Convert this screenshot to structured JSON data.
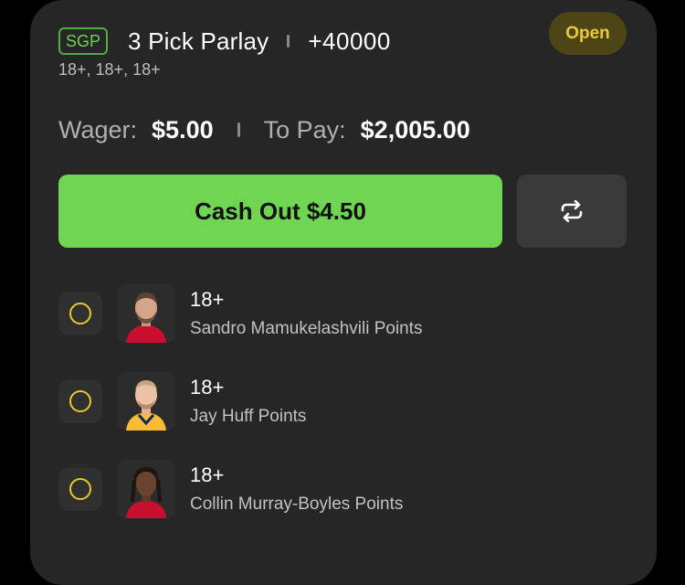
{
  "bet": {
    "badge": "SGP",
    "title": "3 Pick Parlay",
    "odds": "+40000",
    "subline": "18+, 18+, 18+",
    "status": "Open"
  },
  "wager": {
    "wager_label": "Wager:",
    "wager_value": "$5.00",
    "pay_label": "To Pay:",
    "pay_value": "$2,005.00"
  },
  "actions": {
    "cashout_label": "Cash Out $4.50",
    "refresh_icon": "repeat-arrows-icon"
  },
  "legs": [
    {
      "line": "18+",
      "name": "Sandro Mamukelashvili Points",
      "jersey_color": "#c8102e"
    },
    {
      "line": "18+",
      "name": "Jay Huff Points",
      "jersey_color": "#fdbb30"
    },
    {
      "line": "18+",
      "name": "Collin Murray-Boyles Points",
      "jersey_color": "#c8102e"
    }
  ],
  "colors": {
    "accent_green": "#6fd552",
    "open_badge_text": "#ecc93a",
    "check_ring": "#e8c62e"
  }
}
